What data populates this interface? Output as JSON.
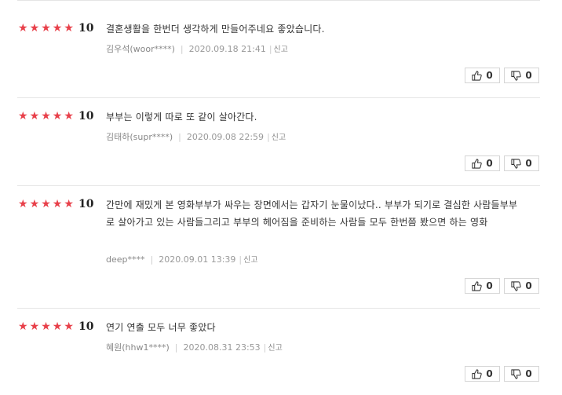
{
  "reviews": [
    {
      "score": "10",
      "text": "결혼생활을 한번더 생각하게 만들어주네요 좋았습니다.",
      "user": "김우석(woor****)",
      "date": "2020.09.18 21:41",
      "report": "신고",
      "likes": "0",
      "dislikes": "0"
    },
    {
      "score": "10",
      "text": "부부는 이렇게 따로 또 같이 살아간다.",
      "user": "김태하(supr****)",
      "date": "2020.09.08 22:59",
      "report": "신고",
      "likes": "0",
      "dislikes": "0"
    },
    {
      "score": "10",
      "text": "간만에 재밌게 본 영화부부가 싸우는 장면에서는 갑자기 눈물이났다.. 부부가 되기로 결심한 사람들부부로 살아가고 있는 사람들그리고 부부의 헤어짐을 준비하는 사람들 모두 한번쯤 봤으면 하는 영화",
      "user": "deep****",
      "date": "2020.09.01 13:39",
      "report": "신고",
      "likes": "0",
      "dislikes": "0"
    },
    {
      "score": "10",
      "text": "연기 연출 모두 너무 좋았다",
      "user": "혜원(hhw1****)",
      "date": "2020.08.31 23:53",
      "report": "신고",
      "likes": "0",
      "dislikes": "0"
    }
  ],
  "rating_stars": 5,
  "colors": {
    "star": "#e8404a",
    "divider": "#e5e5e5"
  },
  "icons": {
    "like": "thumbs-up-icon",
    "dislike": "thumbs-down-icon"
  }
}
